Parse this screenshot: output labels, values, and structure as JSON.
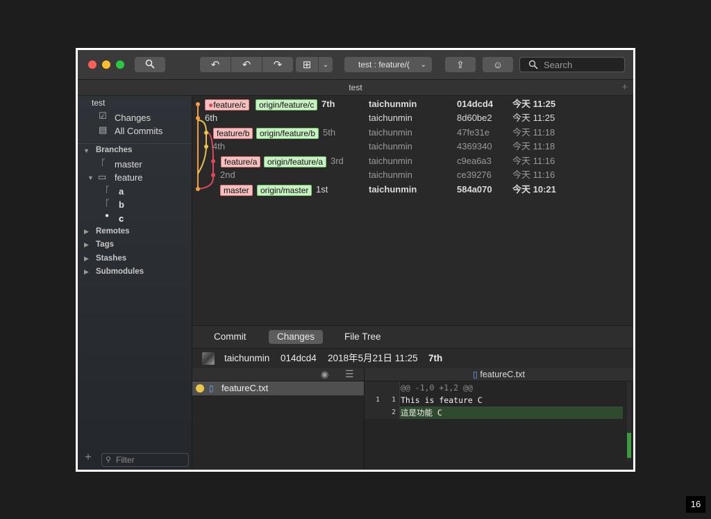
{
  "toolbar": {
    "branch_selector": "test :  feature/(",
    "search_placeholder": "Search"
  },
  "window_title": "test",
  "sidebar": {
    "repo_name": "test",
    "changes": "Changes",
    "all_commits": "All Commits",
    "branches_header": "Branches",
    "master": "master",
    "feature_folder": "feature",
    "branch_a": "a",
    "branch_b": "b",
    "branch_c": "c",
    "remotes": "Remotes",
    "tags": "Tags",
    "stashes": "Stashes",
    "submodules": "Submodules",
    "filter_placeholder": "Filter"
  },
  "commits": [
    {
      "tags": [
        "feature/c",
        "origin/feature/c"
      ],
      "message": "7th",
      "author": "taichunmin",
      "hash": "014dcd4",
      "date": "今天 11:25"
    },
    {
      "tags": [],
      "message": "6th",
      "author": "taichunmin",
      "hash": "8d60be2",
      "date": "今天 11:25"
    },
    {
      "tags": [
        "feature/b",
        "origin/feature/b"
      ],
      "message": "5th",
      "author": "taichunmin",
      "hash": "47fe31e",
      "date": "今天 11:18"
    },
    {
      "tags": [],
      "message": "4th",
      "author": "taichunmin",
      "hash": "4369340",
      "date": "今天 11:18"
    },
    {
      "tags": [
        "feature/a",
        "origin/feature/a"
      ],
      "message": "3rd",
      "author": "taichunmin",
      "hash": "c9ea6a3",
      "date": "今天 11:16"
    },
    {
      "tags": [],
      "message": "2nd",
      "author": "taichunmin",
      "hash": "ce39276",
      "date": "今天 11:16"
    },
    {
      "tags": [
        "master",
        "origin/master"
      ],
      "message": "1st",
      "author": "taichunmin",
      "hash": "584a070",
      "date": "今天 10:21"
    }
  ],
  "tabs": {
    "commit": "Commit",
    "changes": "Changes",
    "file_tree": "File Tree"
  },
  "commit_info": {
    "author": "taichunmin",
    "hash": "014dcd4",
    "date": "2018年5月21日 11:25",
    "message": "7th"
  },
  "file_list": {
    "file": "featureC.txt"
  },
  "diff": {
    "filename": "featureC.txt",
    "hunk": "@@ -1,0 +1,2 @@",
    "line1_old": "1",
    "line1_new": "1",
    "line1_text": "This is feature C",
    "line2_new": "2",
    "line2_text": "這是功能 C"
  },
  "page_number": "16"
}
